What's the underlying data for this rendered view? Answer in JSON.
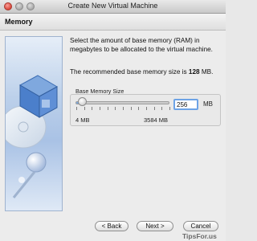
{
  "window": {
    "title": "Create New Virtual Machine"
  },
  "page": {
    "title": "Memory"
  },
  "description": "Select the amount of base memory (RAM) in megabytes to be allocated to the virtual machine.",
  "recommended": {
    "prefix": "The recommended base memory size is ",
    "value": "128",
    "suffix": " MB."
  },
  "memory": {
    "group_label": "Base Memory Size",
    "value": "256",
    "unit": "MB",
    "min_label": "4 MB",
    "max_label": "3584 MB",
    "min": 4,
    "max": 3584,
    "current": 256
  },
  "buttons": {
    "back": "< Back",
    "next": "Next >",
    "cancel": "Cancel"
  },
  "watermark": "TipsFor.us",
  "colors": {
    "accent": "#6da3e6"
  }
}
